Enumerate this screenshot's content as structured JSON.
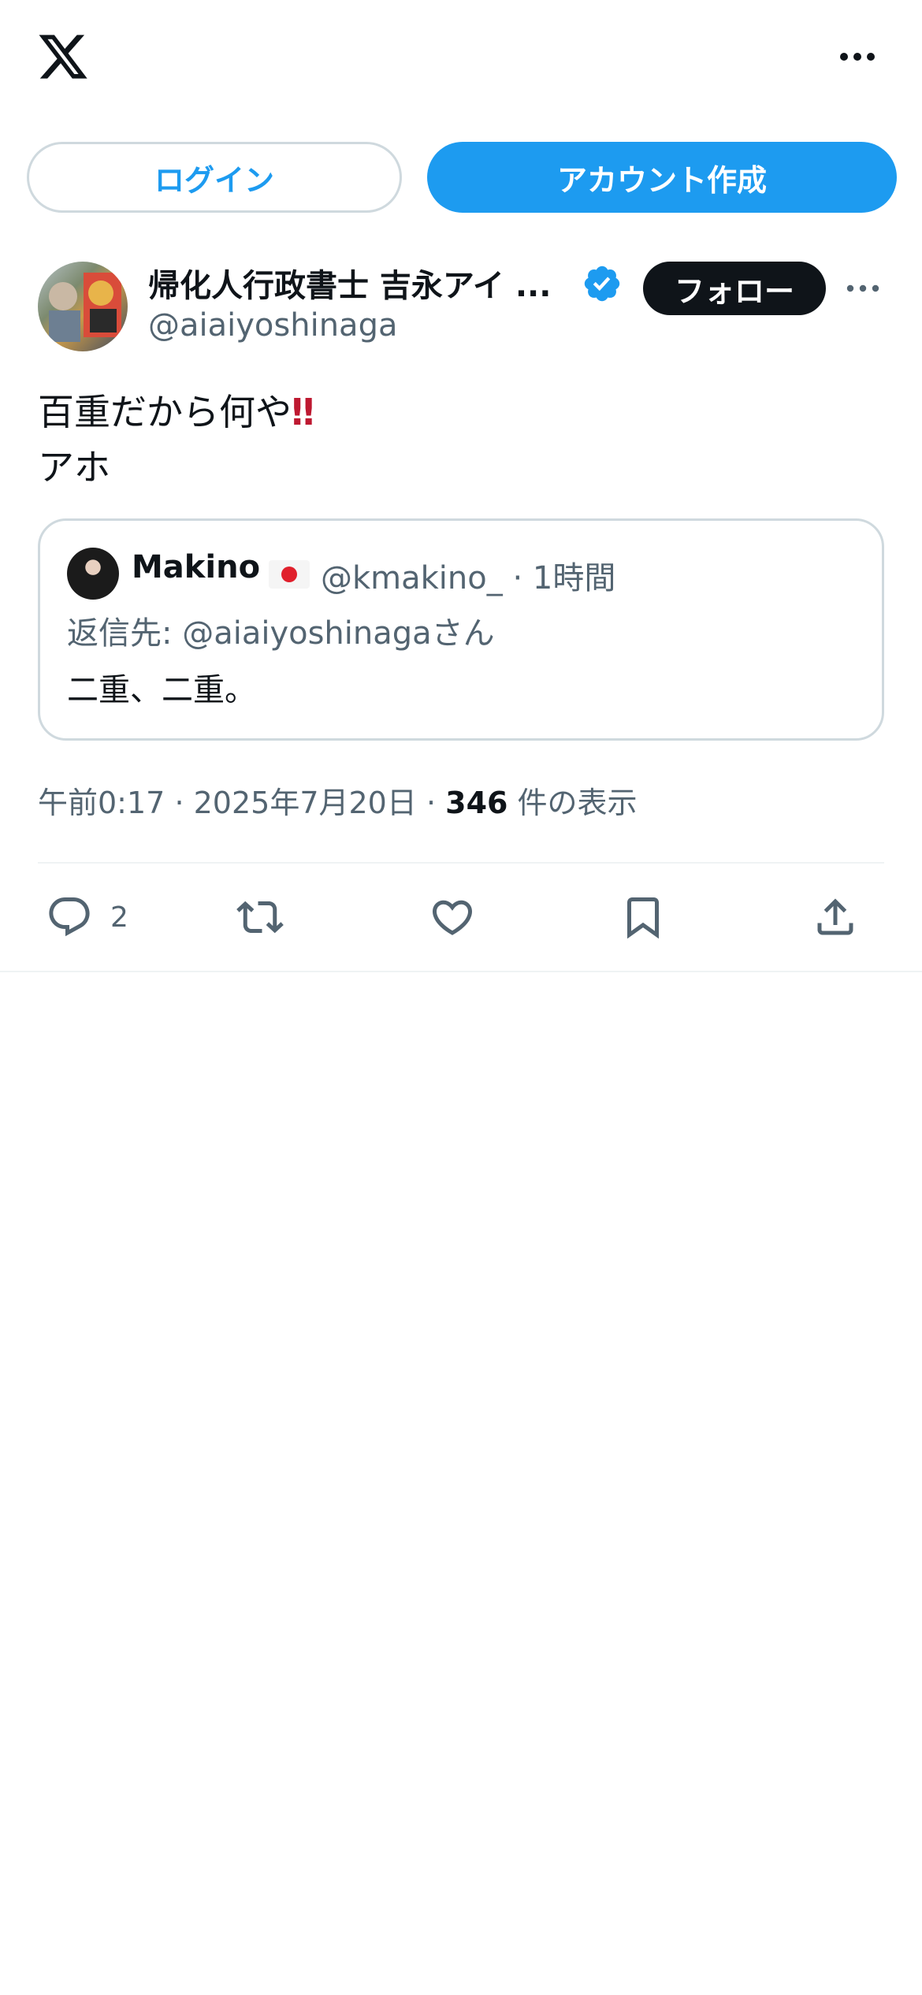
{
  "header": {
    "logo_icon": "x-logo-icon",
    "more_icon": "more-horizontal-icon"
  },
  "auth": {
    "login_label": "ログイン",
    "signup_label": "アカウント作成"
  },
  "post": {
    "author_name": "帰化人行政書士 吉永アイ ...",
    "author_handle": "@aiaiyoshinaga",
    "verified_icon": "verified-badge-icon",
    "follow_label": "フォロー",
    "text_line1": "百重だから何や",
    "text_emoji": "‼",
    "text_line2": "アホ",
    "quote": {
      "name": "Makino",
      "handle_time": "@kmakino_ · 1時間",
      "reply_to": "返信先: @aiaiyoshinagaさん",
      "text": "二重、二重。"
    },
    "time": "午前0:17",
    "date": "2025年7月20日",
    "views_count": "346",
    "views_label": "件の表示",
    "actions": {
      "reply_count": "2"
    }
  },
  "colors": {
    "accent": "#1d9bf0",
    "text_primary": "#0f1419",
    "text_secondary": "#536471",
    "border": "#cfd9de"
  }
}
